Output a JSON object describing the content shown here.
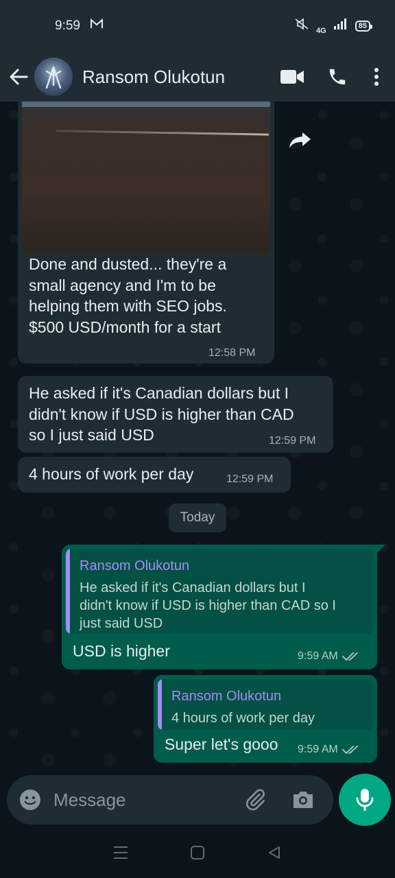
{
  "status_bar": {
    "time": "9:59",
    "network": "4G",
    "battery": "85"
  },
  "header": {
    "contact_name": "Ransom Olukotun",
    "icons": [
      "back-arrow-icon",
      "avatar",
      "video-call-icon",
      "phone-icon",
      "more-options-icon"
    ]
  },
  "messages": [
    {
      "direction": "incoming",
      "type": "image",
      "caption": "Done and dusted... they're a small agency and I'm to be helping them with SEO jobs. $500 USD/month for a start",
      "caption_lines": [
        "Done and dusted... they're a",
        "small agency and I'm to be",
        "helping them with SEO jobs.",
        "$500 USD/month for a start"
      ],
      "time": "12:58 PM"
    },
    {
      "direction": "incoming",
      "text_lines": [
        "He asked if it's Canadian dollars but I",
        "didn't know if USD is higher than CAD",
        "so I just said USD"
      ],
      "time": "12:59 PM"
    },
    {
      "direction": "incoming",
      "text": "4 hours of work per day",
      "time": "12:59 PM"
    }
  ],
  "date_divider": "Today",
  "replies": [
    {
      "direction": "outgoing",
      "quote_author": "Ransom Olukotun",
      "quote_lines": [
        "He asked if it's Canadian dollars but I",
        "didn't know if USD is higher than CAD so I",
        "just said USD"
      ],
      "text": "USD is higher",
      "time": "9:59 AM",
      "status": "read"
    },
    {
      "direction": "outgoing",
      "quote_author": "Ransom Olukotun",
      "quote_text": "4 hours of work per day",
      "text": "Super let's gooo",
      "time": "9:59 AM",
      "status": "read"
    }
  ],
  "composer": {
    "placeholder": "Message"
  },
  "colors": {
    "background": "#0b141a",
    "incoming_bubble": "#1f2c34",
    "outgoing_bubble": "#005c4b",
    "accent": "#00a884",
    "quote_author": "#a78bfa"
  }
}
